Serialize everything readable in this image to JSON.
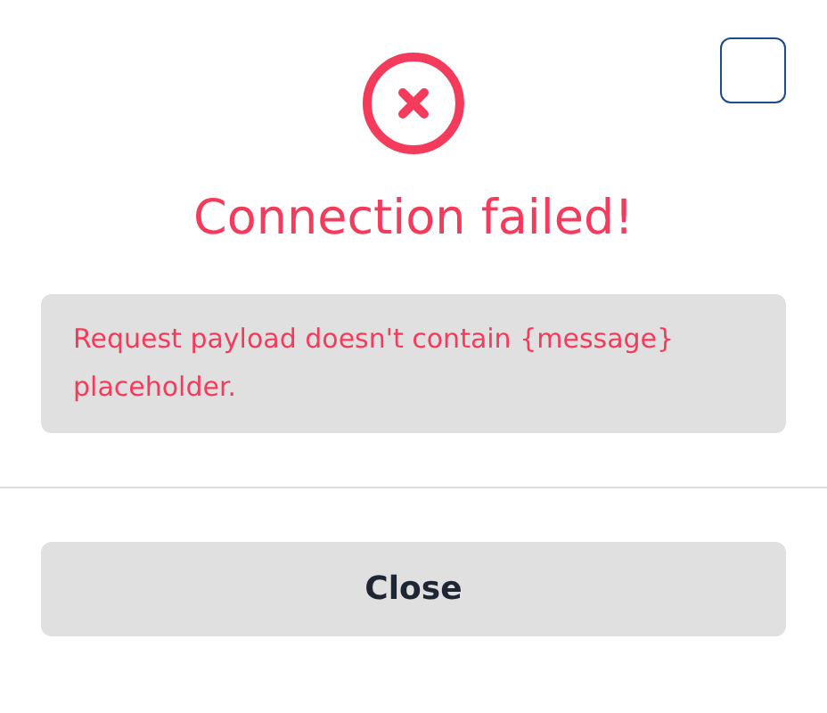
{
  "dialog": {
    "title": "Connection failed!",
    "message": "Request payload doesn't contain {message} placeholder.",
    "buttons": [
      {
        "label": "Close"
      }
    ]
  }
}
